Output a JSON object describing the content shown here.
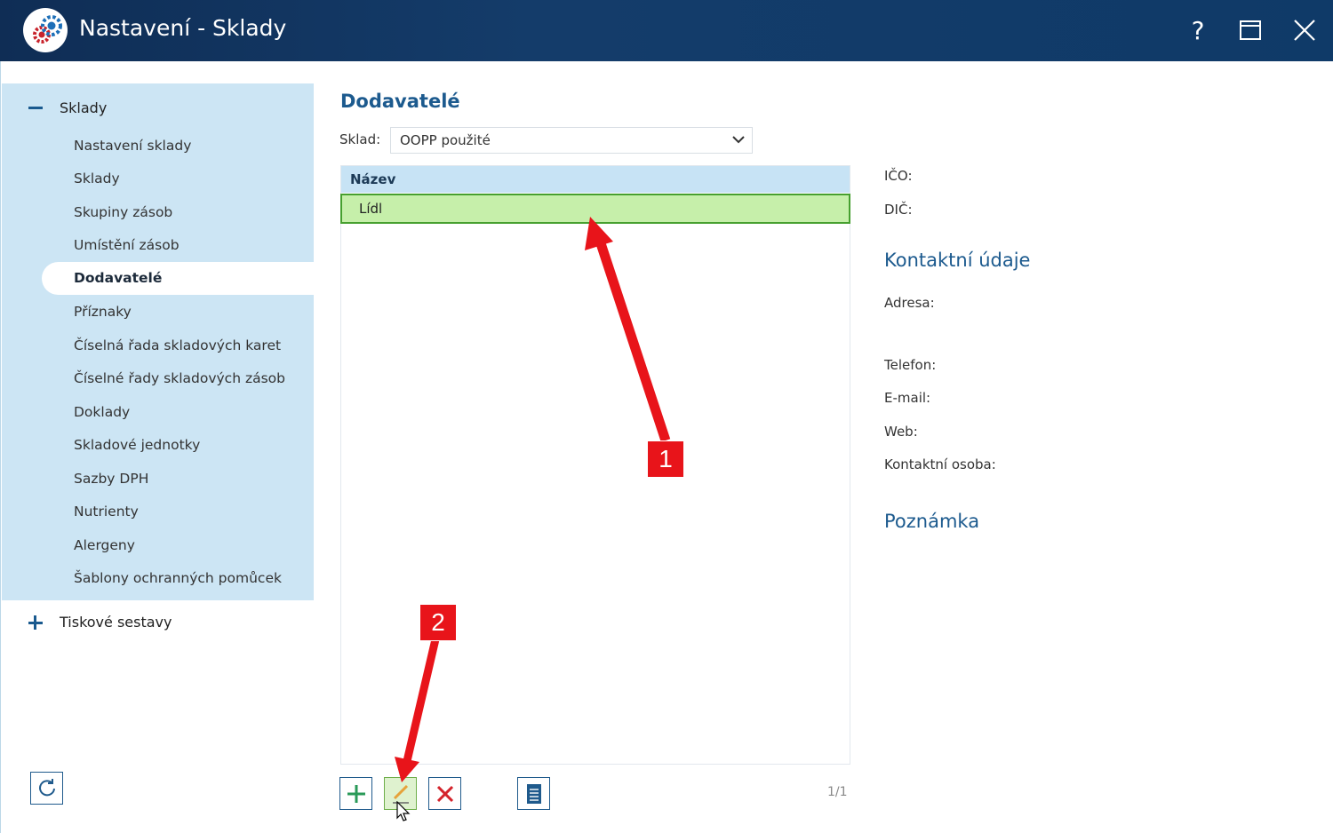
{
  "window": {
    "title": "Nastavení - Sklady",
    "help_label": "?"
  },
  "sidebar": {
    "group1_label": "Sklady",
    "items": [
      {
        "label": "Nastavení sklady"
      },
      {
        "label": "Sklady"
      },
      {
        "label": "Skupiny zásob"
      },
      {
        "label": "Umístění zásob"
      },
      {
        "label": "Dodavatelé",
        "active": true
      },
      {
        "label": "Příznaky"
      },
      {
        "label": "Číselná řada skladových karet"
      },
      {
        "label": "Číselné řady skladových zásob"
      },
      {
        "label": "Doklady"
      },
      {
        "label": "Skladové jednotky"
      },
      {
        "label": "Sazby DPH"
      },
      {
        "label": "Nutrienty"
      },
      {
        "label": "Alergeny"
      },
      {
        "label": "Šablony ochranných pomůcek"
      }
    ],
    "group2_label": "Tiskové sestavy"
  },
  "main": {
    "title": "Dodavatelé",
    "sklad_label": "Sklad:",
    "sklad_value": "OOPP použité",
    "grid_header": "Název",
    "rows": [
      {
        "name": "Lídl",
        "selected": true
      }
    ],
    "pager": "1/1"
  },
  "detail": {
    "ico_label": "IČO:",
    "dic_label": "DIČ:",
    "contact_heading": "Kontaktní údaje",
    "address_label": "Adresa:",
    "phone_label": "Telefon:",
    "email_label": "E-mail:",
    "web_label": "Web:",
    "contact_person_label": "Kontaktní osoba:",
    "note_heading": "Poznámka"
  },
  "annotations": {
    "badge1": "1",
    "badge2": "2"
  },
  "colors": {
    "titlebar": "#143c6a",
    "sidebar_bg": "#cce5f4",
    "accent": "#1c5a8e",
    "selected_row": "#c6efaa",
    "annotation_red": "#e8141a"
  },
  "icons": [
    "app-gears-icon",
    "maximize-icon",
    "close-icon",
    "minus-icon",
    "plus-icon",
    "refresh-icon",
    "chevron-down-icon",
    "add-icon",
    "edit-pencil-icon",
    "delete-x-icon",
    "document-icon",
    "mouse-cursor-icon"
  ]
}
